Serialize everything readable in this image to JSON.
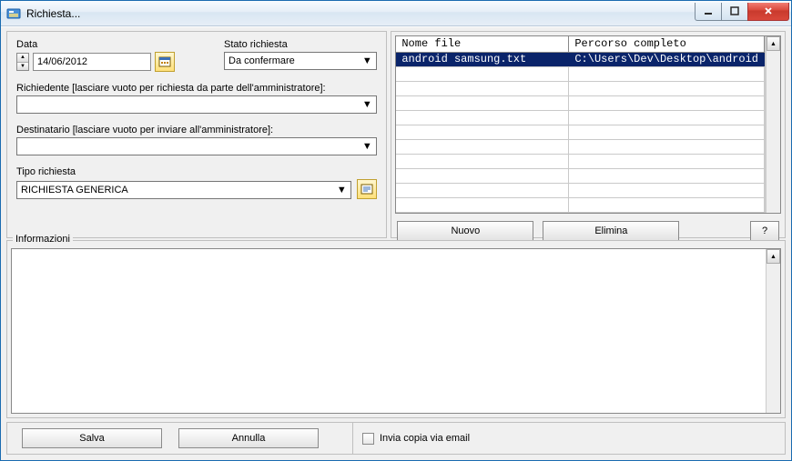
{
  "window": {
    "title": "Richiesta..."
  },
  "form": {
    "data_label": "Data",
    "data_value": "14/06/2012",
    "stato_label": "Stato richiesta",
    "stato_value": "Da confermare",
    "richiedente_label": "Richiedente [lasciare vuoto per richiesta da parte dell'amministratore]:",
    "richiedente_value": "",
    "destinatario_label": "Destinatario [lasciare vuoto per inviare all'amministratore]:",
    "destinatario_value": "",
    "tipo_label": "Tipo richiesta",
    "tipo_value": "RICHIESTA GENERICA"
  },
  "table": {
    "col_file": "Nome file",
    "col_path": "Percorso completo",
    "rows": [
      {
        "file": "android samsung.txt",
        "path": "C:\\Users\\Dev\\Desktop\\android"
      }
    ],
    "nuovo": "Nuovo",
    "elimina": "Elimina",
    "help": "?"
  },
  "info": {
    "legend": "Informazioni"
  },
  "footer": {
    "salva": "Salva",
    "annulla": "Annulla",
    "email_label": "Invia copia via email",
    "email_checked": false
  }
}
